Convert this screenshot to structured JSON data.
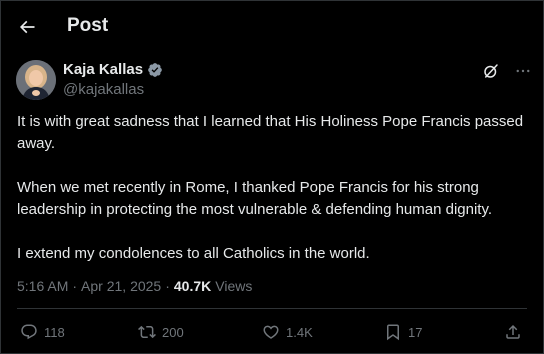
{
  "header": {
    "title": "Post",
    "back_icon": "arrow-left-icon"
  },
  "author": {
    "display_name": "Kaja Kallas",
    "handle": "@kajakallas",
    "verified_icon": "verified-badge-icon",
    "verified_color": "#1d9bf0"
  },
  "tweet": {
    "paragraphs": [
      "It is with great sadness that I learned that His Holiness Pope Francis passed away.",
      "When we met recently in Rome, I thanked Pope Francis for his strong leadership in protecting the most vulnerable & defending human dignity.",
      "I extend my condolences to all Catholics in the world."
    ]
  },
  "meta": {
    "time": "5:16 AM",
    "separator": "·",
    "date": "Apr 21, 2025",
    "views_count": "40.7K",
    "views_label": "Views"
  },
  "actions": {
    "replies": "118",
    "reposts": "200",
    "likes": "1.4K",
    "bookmarks": "17"
  },
  "colors": {
    "background": "#000000",
    "text_primary": "#e7e9ea",
    "text_secondary": "#71767b",
    "border": "#2f3336",
    "accent": "#1d9bf0"
  }
}
